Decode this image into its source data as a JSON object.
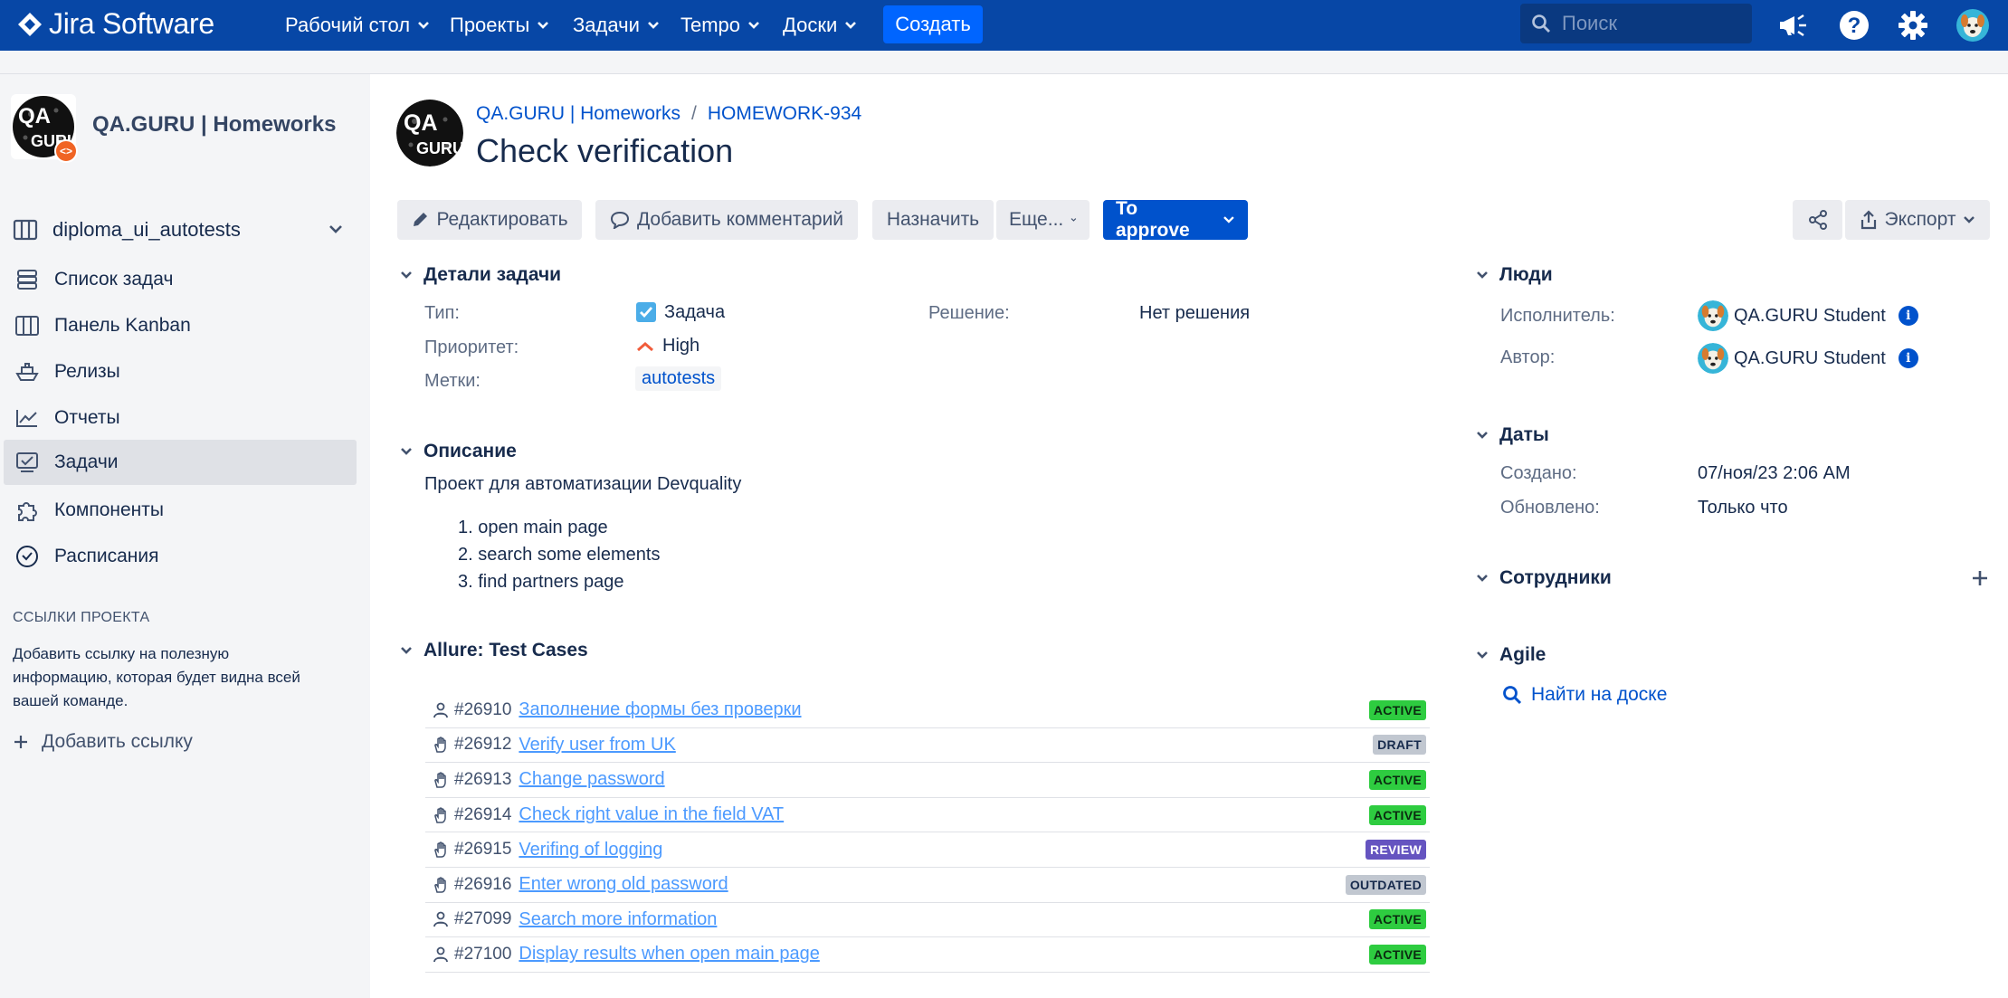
{
  "app": {
    "name": "Jira Software"
  },
  "topnav": {
    "items": [
      {
        "label": "Рабочий стол"
      },
      {
        "label": "Проекты"
      },
      {
        "label": "Задачи"
      },
      {
        "label": "Tempo"
      },
      {
        "label": "Доски"
      }
    ],
    "create_label": "Создать",
    "search_placeholder": "Поиск",
    "icons": [
      "megaphone-icon",
      "help-icon",
      "settings-icon",
      "user-avatar"
    ]
  },
  "sidebar": {
    "project_name": "QA.GURU | Homeworks",
    "board_name": "diploma_ui_autotests",
    "items": [
      {
        "label": "Список задач",
        "icon": "backlog-icon"
      },
      {
        "label": "Панель Kanban",
        "icon": "board-icon"
      },
      {
        "label": "Релизы",
        "icon": "ship-icon"
      },
      {
        "label": "Отчеты",
        "icon": "chart-icon"
      },
      {
        "label": "Задачи",
        "icon": "issues-icon",
        "active": true
      },
      {
        "label": "Компоненты",
        "icon": "puzzle-icon"
      },
      {
        "label": "Расписания",
        "icon": "clock-icon"
      }
    ],
    "section_title": "ССЫЛКИ ПРОЕКТА",
    "help_text": "Добавить ссылку на полезную информацию, которая будет видна всей вашей команде.",
    "add_link_label": "Добавить ссылку"
  },
  "issue": {
    "breadcrumb_project": "QA.GURU | Homeworks",
    "breadcrumb_sep": "/",
    "key": "HOMEWORK-934",
    "title": "Check verification"
  },
  "toolbar": {
    "edit": "Редактировать",
    "comment": "Добавить комментарий",
    "assign": "Назначить",
    "more": "Еще...",
    "status": "To approve",
    "export": "Экспорт"
  },
  "details": {
    "heading": "Детали задачи",
    "type_label": "Тип:",
    "type_value": "Задача",
    "priority_label": "Приоритет:",
    "priority_value": "High",
    "labels_label": "Метки:",
    "labels_value": "autotests",
    "resolution_label": "Решение:",
    "resolution_value": "Нет решения"
  },
  "description": {
    "heading": "Описание",
    "text": "Проект для автоматизации Devquality",
    "steps": [
      "1. open main page",
      "2. search some elements",
      "3. find partners page"
    ]
  },
  "allure": {
    "heading": "Allure: Test Cases",
    "rows": [
      {
        "id": "#26910",
        "title": "Заполнение формы без проверки",
        "status": "ACTIVE",
        "kind": "auto"
      },
      {
        "id": "#26912",
        "title": "Verify user from UK",
        "status": "DRAFT",
        "kind": "manual"
      },
      {
        "id": "#26913",
        "title": "Change password",
        "status": "ACTIVE",
        "kind": "manual"
      },
      {
        "id": "#26914",
        "title": "Check right value in the field VAT",
        "status": "ACTIVE",
        "kind": "manual"
      },
      {
        "id": "#26915",
        "title": "Verifing of logging",
        "status": "REVIEW",
        "kind": "manual"
      },
      {
        "id": "#26916",
        "title": "Enter wrong old password",
        "status": "OUTDATED",
        "kind": "manual"
      },
      {
        "id": "#27099",
        "title": "Search more information",
        "status": "ACTIVE",
        "kind": "auto"
      },
      {
        "id": "#27100",
        "title": "Display results when open main page",
        "status": "ACTIVE",
        "kind": "auto"
      }
    ],
    "status_colors": {
      "ACTIVE": {
        "bg": "#2ecc40",
        "fg": "#0b2a10"
      },
      "DRAFT": {
        "bg": "#c1c7d0",
        "fg": "#172b4d"
      },
      "REVIEW": {
        "bg": "#6554c0",
        "fg": "#ffffff"
      },
      "OUTDATED": {
        "bg": "#c1c7d0",
        "fg": "#172b4d"
      }
    }
  },
  "people": {
    "heading": "Люди",
    "assignee_label": "Исполнитель:",
    "assignee": "QA.GURU Student",
    "reporter_label": "Автор:",
    "reporter": "QA.GURU Student"
  },
  "dates": {
    "heading": "Даты",
    "created_label": "Создано:",
    "created": "07/ноя/23 2:06 AM",
    "updated_label": "Обновлено:",
    "updated": "Только что"
  },
  "staff": {
    "heading": "Сотрудники"
  },
  "agile": {
    "heading": "Agile",
    "find_on_board": "Найти на доске"
  },
  "colors": {
    "nav": "#0747a6",
    "primary": "#0052cc",
    "create": "#0065ff"
  }
}
